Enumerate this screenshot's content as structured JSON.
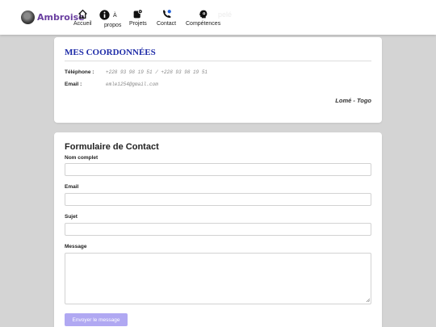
{
  "header": {
    "brand": "Ambroise",
    "ghost_text": "pelé",
    "nav": [
      {
        "label": "Accueil",
        "icon": "home-icon"
      },
      {
        "label_line1": "À",
        "label_line2": "propos",
        "icon": "info-icon"
      },
      {
        "label": "Projets",
        "icon": "projects-icon"
      },
      {
        "label": "Contact",
        "icon": "phone-icon"
      },
      {
        "label": "Compétences",
        "icon": "skills-icon"
      }
    ]
  },
  "coordinates": {
    "title": "MES COORDONNÉES",
    "phone_label": "Téléphone :",
    "phone_value": "+228 93 98 19 51 / +228 93 98 19 51",
    "email_label": "Email :",
    "email_value": "emle1254@gmail.com",
    "location": "Lomé - Togo"
  },
  "form": {
    "title": "Formulaire de Contact",
    "name_label": "Nom complet",
    "email_label": "Email",
    "subject_label": "Sujet",
    "message_label": "Message",
    "name_value": "",
    "email_value": "",
    "subject_value": "",
    "message_value": "",
    "submit_label": "Envoyer le message"
  },
  "colors": {
    "brand": "#6a3fa0",
    "coord_title": "#1f2ca8",
    "submit_button": "#b0a8f2",
    "page_background": "#d4d4d4"
  }
}
